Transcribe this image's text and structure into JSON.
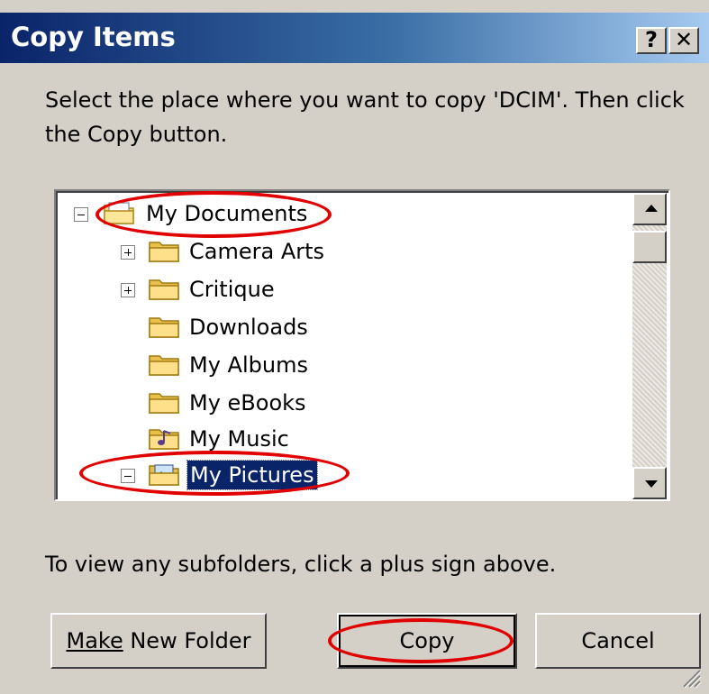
{
  "window": {
    "title": "Copy Items",
    "help_label": "?",
    "close_label": "✕"
  },
  "instruction": "Select the place where you want to copy 'DCIM'. Then click the Copy button.",
  "tree": {
    "items": [
      {
        "label": "My Documents",
        "expander": "minus",
        "icon": "my-documents-icon"
      },
      {
        "label": "Camera Arts",
        "expander": "plus",
        "icon": "folder-icon"
      },
      {
        "label": "Critique",
        "expander": "plus",
        "icon": "folder-icon"
      },
      {
        "label": "Downloads",
        "expander": "none",
        "icon": "folder-icon"
      },
      {
        "label": "My Albums",
        "expander": "none",
        "icon": "folder-icon"
      },
      {
        "label": "My eBooks",
        "expander": "none",
        "icon": "folder-icon"
      },
      {
        "label": "My Music",
        "expander": "none",
        "icon": "music-folder-icon"
      },
      {
        "label": "My Pictures",
        "expander": "minus",
        "icon": "pictures-folder-icon",
        "selected": true
      }
    ]
  },
  "hint": "To view any subfolders, click a plus sign above.",
  "buttons": {
    "make_new_folder_pre": "Make",
    "make_new_folder_post": " New Folder",
    "copy": "Copy",
    "cancel": "Cancel"
  },
  "colors": {
    "annotation": "#e00000",
    "selection": "#0a246a",
    "face": "#d4d0c8"
  }
}
